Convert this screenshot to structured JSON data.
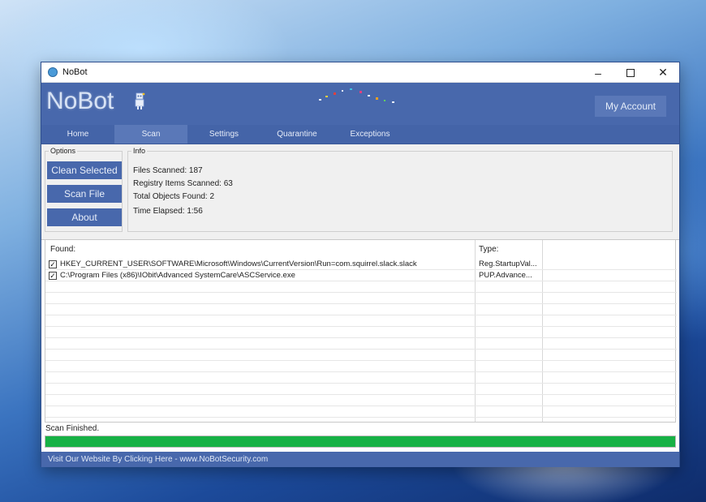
{
  "window": {
    "title": "NoBot",
    "controls": {
      "minimize": "–",
      "close": "✕"
    }
  },
  "banner": {
    "logo_text": "NoBot",
    "account_button": "My Account"
  },
  "tabs": [
    {
      "label": "Home"
    },
    {
      "label": "Scan",
      "active": true
    },
    {
      "label": "Settings"
    },
    {
      "label": "Quarantine"
    },
    {
      "label": "Exceptions"
    }
  ],
  "options": {
    "group_label": "Options",
    "buttons": [
      "Clean Selected",
      "Scan File",
      "About"
    ]
  },
  "info": {
    "group_label": "Info",
    "lines": [
      "Files Scanned: 187",
      "Registry Items Scanned: 63",
      "Total Objects Found: 2",
      "Time Elapsed: 1:56"
    ]
  },
  "results": {
    "headers": {
      "found": "Found:",
      "type": "Type:"
    },
    "rows": [
      {
        "checked": true,
        "path": "HKEY_CURRENT_USER\\SOFTWARE\\Microsoft\\Windows\\CurrentVersion\\Run=com.squirrel.slack.slack",
        "type": "Reg.StartupVal..."
      },
      {
        "checked": true,
        "path": "C:\\Program Files (x86)\\IObit\\Advanced SystemCare\\ASCService.exe",
        "type": "PUP.Advance..."
      }
    ]
  },
  "status": {
    "text": "Scan Finished.",
    "progress_fraction": 1.0
  },
  "footer": {
    "link_text": "Visit Our Website By Clicking Here - www.NoBotSecurity.com"
  },
  "colors": {
    "brand_blue": "#4868ac",
    "progress_green": "#17b145"
  }
}
